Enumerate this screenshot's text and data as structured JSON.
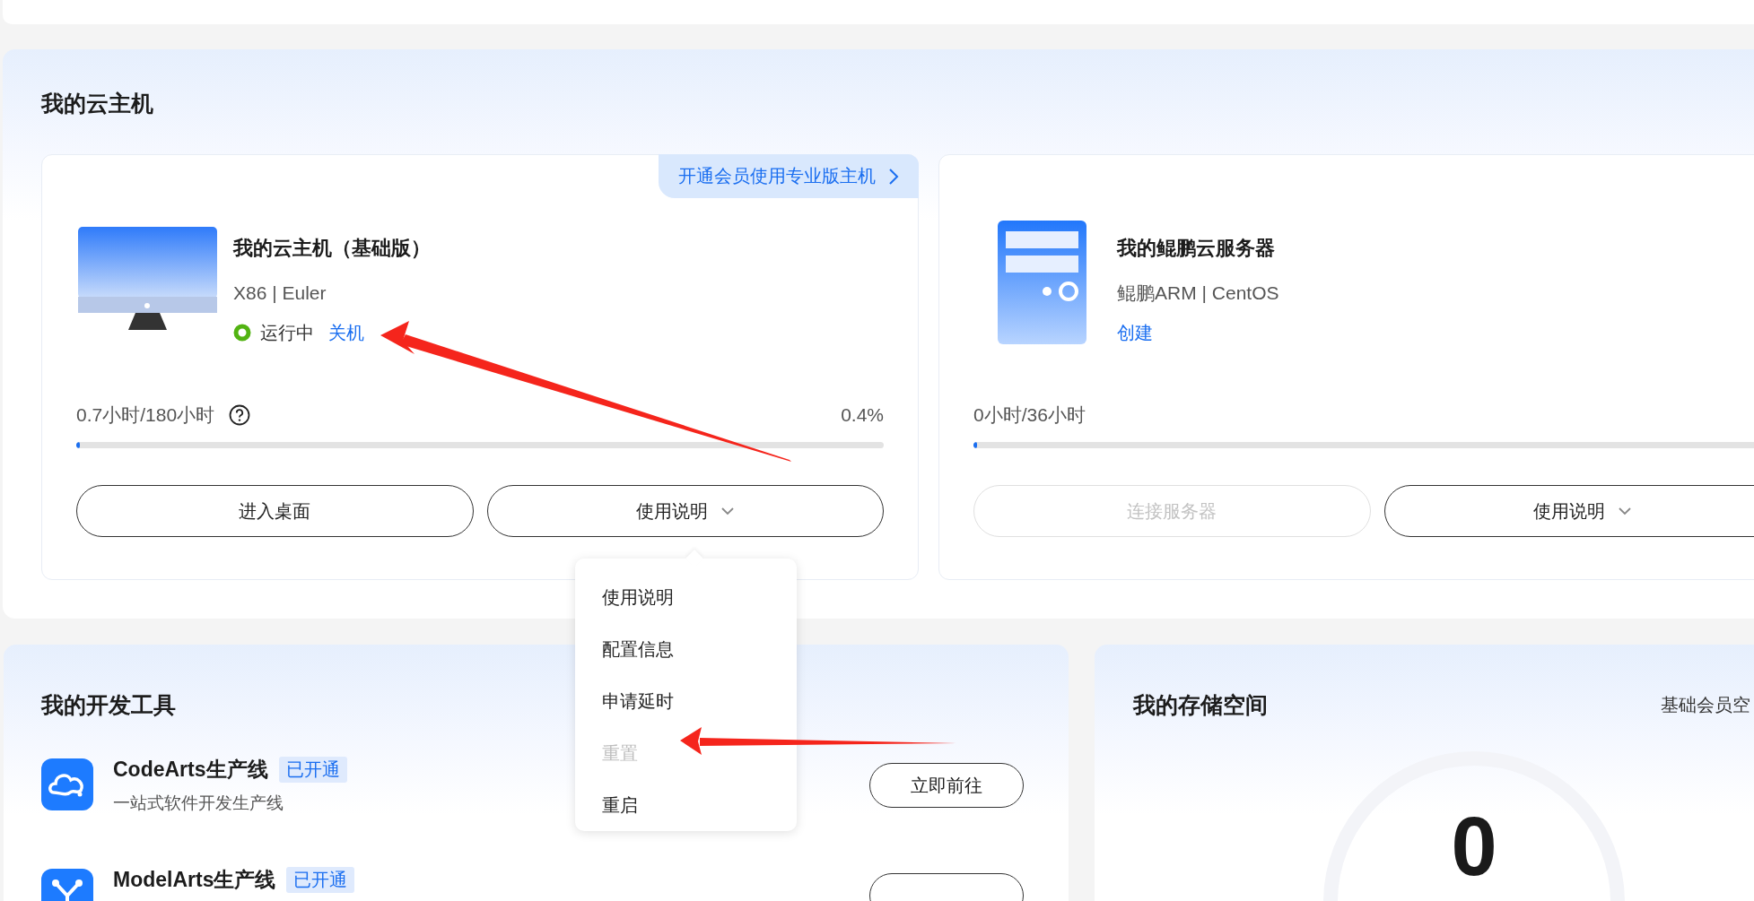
{
  "vm_section": {
    "title": "我的云主机",
    "cards": [
      {
        "kind": "desktop",
        "promo": "开通会员使用专业版主机",
        "name": "我的云主机（基础版）",
        "spec": "X86 | Euler",
        "status": {
          "text": "运行中",
          "running": true
        },
        "action": "关机",
        "usage": "0.7小时/180小时",
        "help": true,
        "percent": "0.4%",
        "level": 0.004,
        "buttons": [
          {
            "label": "进入桌面",
            "disabled": false,
            "dropdown": false
          },
          {
            "label": "使用说明",
            "disabled": false,
            "dropdown": true
          }
        ]
      },
      {
        "kind": "server",
        "name": "我的鲲鹏云服务器",
        "spec": "鲲鹏ARM | CentOS",
        "action": "创建",
        "usage": "0小时/36小时",
        "help": false,
        "level": 0,
        "buttons": [
          {
            "label": "连接服务器",
            "disabled": true,
            "dropdown": false
          },
          {
            "label": "使用说明",
            "disabled": false,
            "dropdown": true
          }
        ]
      }
    ]
  },
  "dropdown_menu": {
    "items": [
      {
        "label": "使用说明",
        "disabled": false
      },
      {
        "label": "配置信息",
        "disabled": false
      },
      {
        "label": "申请延时",
        "disabled": false
      },
      {
        "label": "重置",
        "disabled": true
      },
      {
        "label": "重启",
        "disabled": false
      }
    ]
  },
  "dev_tools": {
    "title": "我的开发工具",
    "items": [
      {
        "kind": "cloud",
        "name": "CodeArts生产线",
        "badge": "已开通",
        "description": "一站式软件开发生产线",
        "button": "立即前往"
      },
      {
        "kind": "model",
        "name": "ModelArts生产线",
        "badge": "已开通"
      }
    ]
  },
  "storage": {
    "title": "我的存储空间",
    "plan": "基础会员空",
    "percent": "0"
  }
}
